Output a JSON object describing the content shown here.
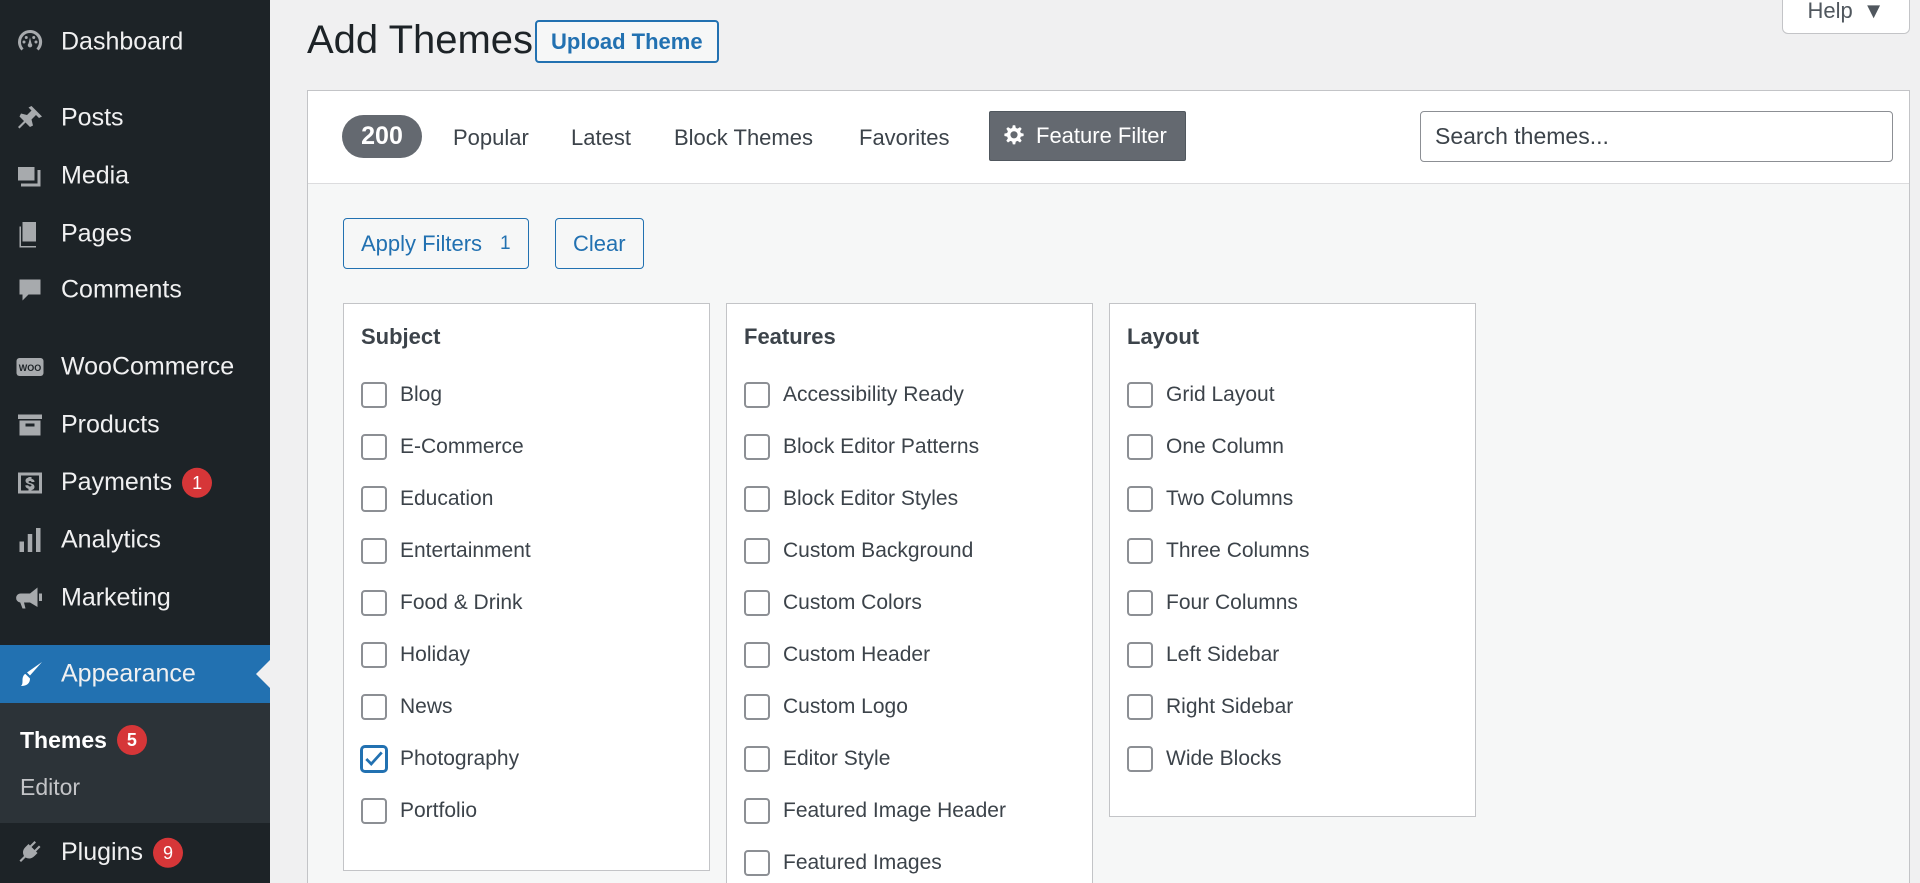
{
  "sidebar": {
    "items": [
      {
        "label": "Dashboard",
        "icon": "dashboard-icon"
      },
      {
        "label": "Posts",
        "icon": "pushpin-icon"
      },
      {
        "label": "Media",
        "icon": "media-icon"
      },
      {
        "label": "Pages",
        "icon": "pages-icon"
      },
      {
        "label": "Comments",
        "icon": "comment-icon"
      },
      {
        "label": "WooCommerce",
        "icon": "woo-icon"
      },
      {
        "label": "Products",
        "icon": "archive-icon"
      },
      {
        "label": "Payments",
        "icon": "dollar-icon",
        "badge": "1"
      },
      {
        "label": "Analytics",
        "icon": "bar-chart-icon"
      },
      {
        "label": "Marketing",
        "icon": "megaphone-icon"
      },
      {
        "label": "Appearance",
        "icon": "paintbrush-icon"
      },
      {
        "label": "Plugins",
        "icon": "plugin-icon",
        "badge": "9"
      }
    ],
    "submenu": [
      {
        "label": "Themes",
        "badge": "5"
      },
      {
        "label": "Editor"
      }
    ]
  },
  "header": {
    "title": "Add Themes",
    "upload_label": "Upload Theme",
    "help_label": "Help"
  },
  "filter_bar": {
    "count": "200",
    "links": [
      "Popular",
      "Latest",
      "Block Themes",
      "Favorites"
    ],
    "feature_filter_label": "Feature Filter",
    "search_placeholder": "Search themes..."
  },
  "filter_actions": {
    "apply_label": "Apply Filters",
    "apply_count": "1",
    "clear_label": "Clear"
  },
  "groups": {
    "subject": {
      "title": "Subject",
      "options": [
        "Blog",
        "E-Commerce",
        "Education",
        "Entertainment",
        "Food & Drink",
        "Holiday",
        "News",
        "Photography",
        "Portfolio"
      ],
      "checked": [
        "Photography"
      ]
    },
    "features": {
      "title": "Features",
      "options": [
        "Accessibility Ready",
        "Block Editor Patterns",
        "Block Editor Styles",
        "Custom Background",
        "Custom Colors",
        "Custom Header",
        "Custom Logo",
        "Editor Style",
        "Featured Image Header",
        "Featured Images"
      ]
    },
    "layout": {
      "title": "Layout",
      "options": [
        "Grid Layout",
        "One Column",
        "Two Columns",
        "Three Columns",
        "Four Columns",
        "Left Sidebar",
        "Right Sidebar",
        "Wide Blocks"
      ]
    }
  },
  "colors": {
    "sidebar_bg": "#1d2327",
    "accent": "#2271b1",
    "badge": "#d63638",
    "check": "#2271b1"
  }
}
